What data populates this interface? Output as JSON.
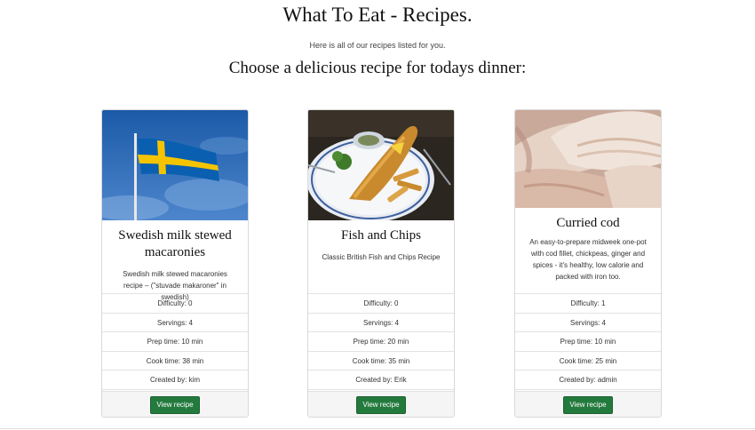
{
  "header": {
    "title": "What To Eat - Recipes.",
    "subtitle": "Here is all of our recipes listed for you.",
    "heading": "Choose a delicious recipe for todays dinner:"
  },
  "recipes": [
    {
      "title": "Swedish milk stewed macaronies",
      "description": "Swedish milk stewed macaronies recipe – (\"stuvade makaroner\" in swedish)",
      "difficulty": "Difficulty: 0",
      "servings": "Servings: 4",
      "prep_time": "Prep time: 10 min",
      "cook_time": "Cook time: 38 min",
      "created_by": "Created by: kim",
      "button_label": "View recipe",
      "image": "swedish-flag-photo"
    },
    {
      "title": "Fish and Chips",
      "description": "Classic British Fish and Chips Recipe",
      "difficulty": "Difficulty: 0",
      "servings": "Servings: 4",
      "prep_time": "Prep time: 20 min",
      "cook_time": "Cook time: 35 min",
      "created_by": "Created by: Erik",
      "button_label": "View recipe",
      "image": "fish-and-chips-photo"
    },
    {
      "title": "Curried cod",
      "description": "An easy-to-prepare midweek one-pot with cod fillet, chickpeas, ginger and spices - it's healthy, low calorie and packed with iron too.",
      "difficulty": "Difficulty: 1",
      "servings": "Servings: 4",
      "prep_time": "Prep time: 10 min",
      "cook_time": "Cook time: 25 min",
      "created_by": "Created by: admin",
      "button_label": "View recipe",
      "image": "raw-cod-fillet-photo"
    }
  ],
  "colors": {
    "button": "#237a3d",
    "card_border": "#d9d9d9",
    "footer_bg": "#f5f5f5"
  }
}
